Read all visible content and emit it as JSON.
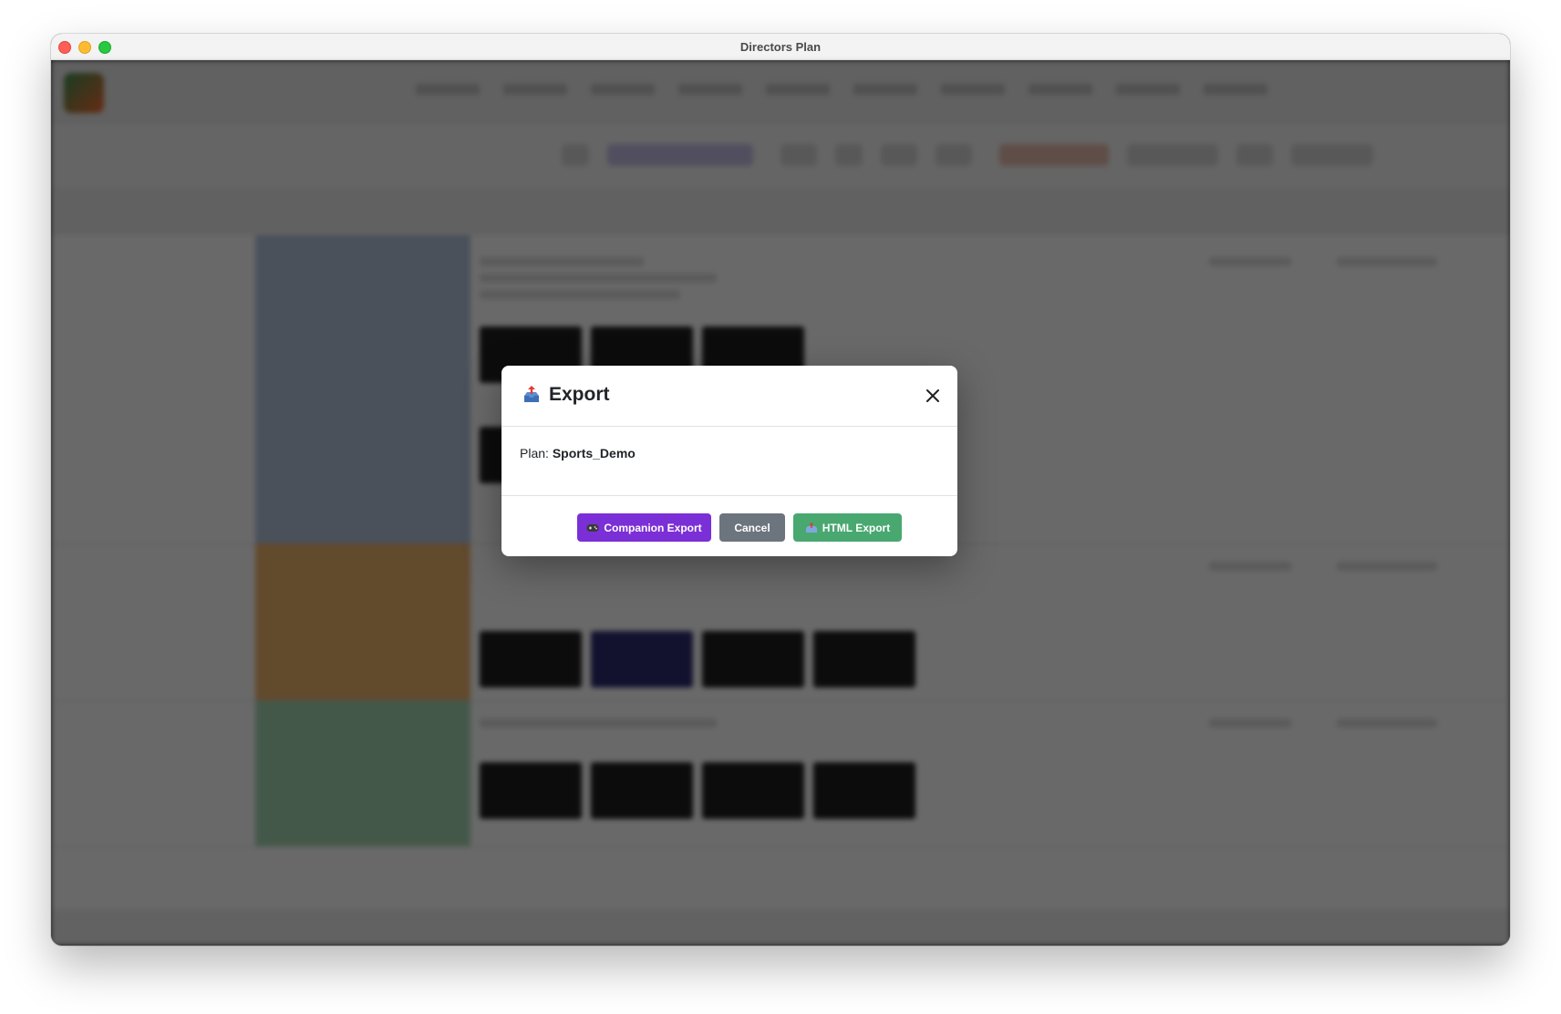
{
  "window": {
    "title": "Directors Plan"
  },
  "modal": {
    "title": "Export",
    "title_icon": "export-tray-icon",
    "close_icon": "close-icon",
    "plan_label": "Plan:",
    "plan_name": "Sports_Demo",
    "buttons": {
      "companion_export": {
        "label": "Companion Export",
        "icon": "gamepad-icon",
        "color": "#7b2fd6"
      },
      "cancel": {
        "label": "Cancel",
        "color": "#6c757d"
      },
      "html_export": {
        "label": "HTML Export",
        "icon": "export-tray-icon",
        "color": "#48a870"
      }
    }
  }
}
